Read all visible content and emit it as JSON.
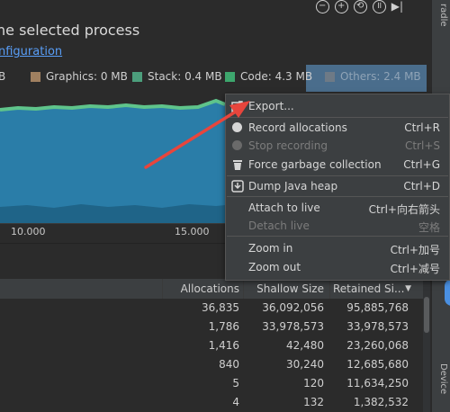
{
  "header": {
    "title": "he selected process",
    "config_link": "nfiguration",
    "icons": [
      "minus-circle-icon",
      "plus-circle-icon",
      "reset-circle-icon",
      "pause-circle-icon",
      "skip-end-icon"
    ]
  },
  "side_panel": {
    "top_label": "radle",
    "bottom_label": "Device"
  },
  "legend": {
    "items": [
      {
        "label": "B",
        "color": ""
      },
      {
        "label": "Graphics: 0 MB",
        "color": "#a08060"
      },
      {
        "label": "Stack: 0.4 MB",
        "color": "#4c9e7c"
      },
      {
        "label": "Code: 4.3 MB",
        "color": "#3da66d"
      },
      {
        "label": "Others: 2.4 MB",
        "color": "#6e7a86"
      }
    ],
    "highlight_color": "#4a6d8c"
  },
  "chart": {
    "area_color": "#2a7da8",
    "line_color": "#5fc48b",
    "ticks": [
      "10.000",
      "15.000"
    ]
  },
  "context_menu": {
    "items": [
      {
        "label": "Export...",
        "shortcut": "",
        "enabled": true,
        "icon": "export-icon"
      },
      {
        "label": "Record allocations",
        "shortcut": "Ctrl+R",
        "enabled": true,
        "icon": "record-dot-icon"
      },
      {
        "label": "Stop recording",
        "shortcut": "Ctrl+S",
        "enabled": false,
        "icon": "stop-dot-icon"
      },
      {
        "label": "Force garbage collection",
        "shortcut": "Ctrl+G",
        "enabled": true,
        "icon": "trash-icon"
      },
      {
        "label": "Dump Java heap",
        "shortcut": "Ctrl+D",
        "enabled": true,
        "icon": "dump-heap-icon"
      },
      {
        "label": "Attach to live",
        "shortcut": "Ctrl+向右箭头",
        "enabled": true,
        "icon": ""
      },
      {
        "label": "Detach live",
        "shortcut": "空格",
        "enabled": false,
        "icon": ""
      },
      {
        "label": "Zoom in",
        "shortcut": "Ctrl+加号",
        "enabled": true,
        "icon": ""
      },
      {
        "label": "Zoom out",
        "shortcut": "Ctrl+减号",
        "enabled": true,
        "icon": ""
      }
    ]
  },
  "table": {
    "columns": [
      "Allocations",
      "Shallow Size",
      "Retained Si..."
    ],
    "sort_indicator": "▼",
    "rows": [
      [
        "36,835",
        "36,092,056",
        "95,885,768"
      ],
      [
        "1,786",
        "33,978,573",
        "33,978,573"
      ],
      [
        "1,416",
        "42,480",
        "23,260,068"
      ],
      [
        "840",
        "30,240",
        "12,685,680"
      ],
      [
        "5",
        "120",
        "11,634,250"
      ],
      [
        "4",
        "132",
        "1,382,532"
      ]
    ]
  },
  "annotation": {
    "arrow_color": "#e8453c"
  }
}
